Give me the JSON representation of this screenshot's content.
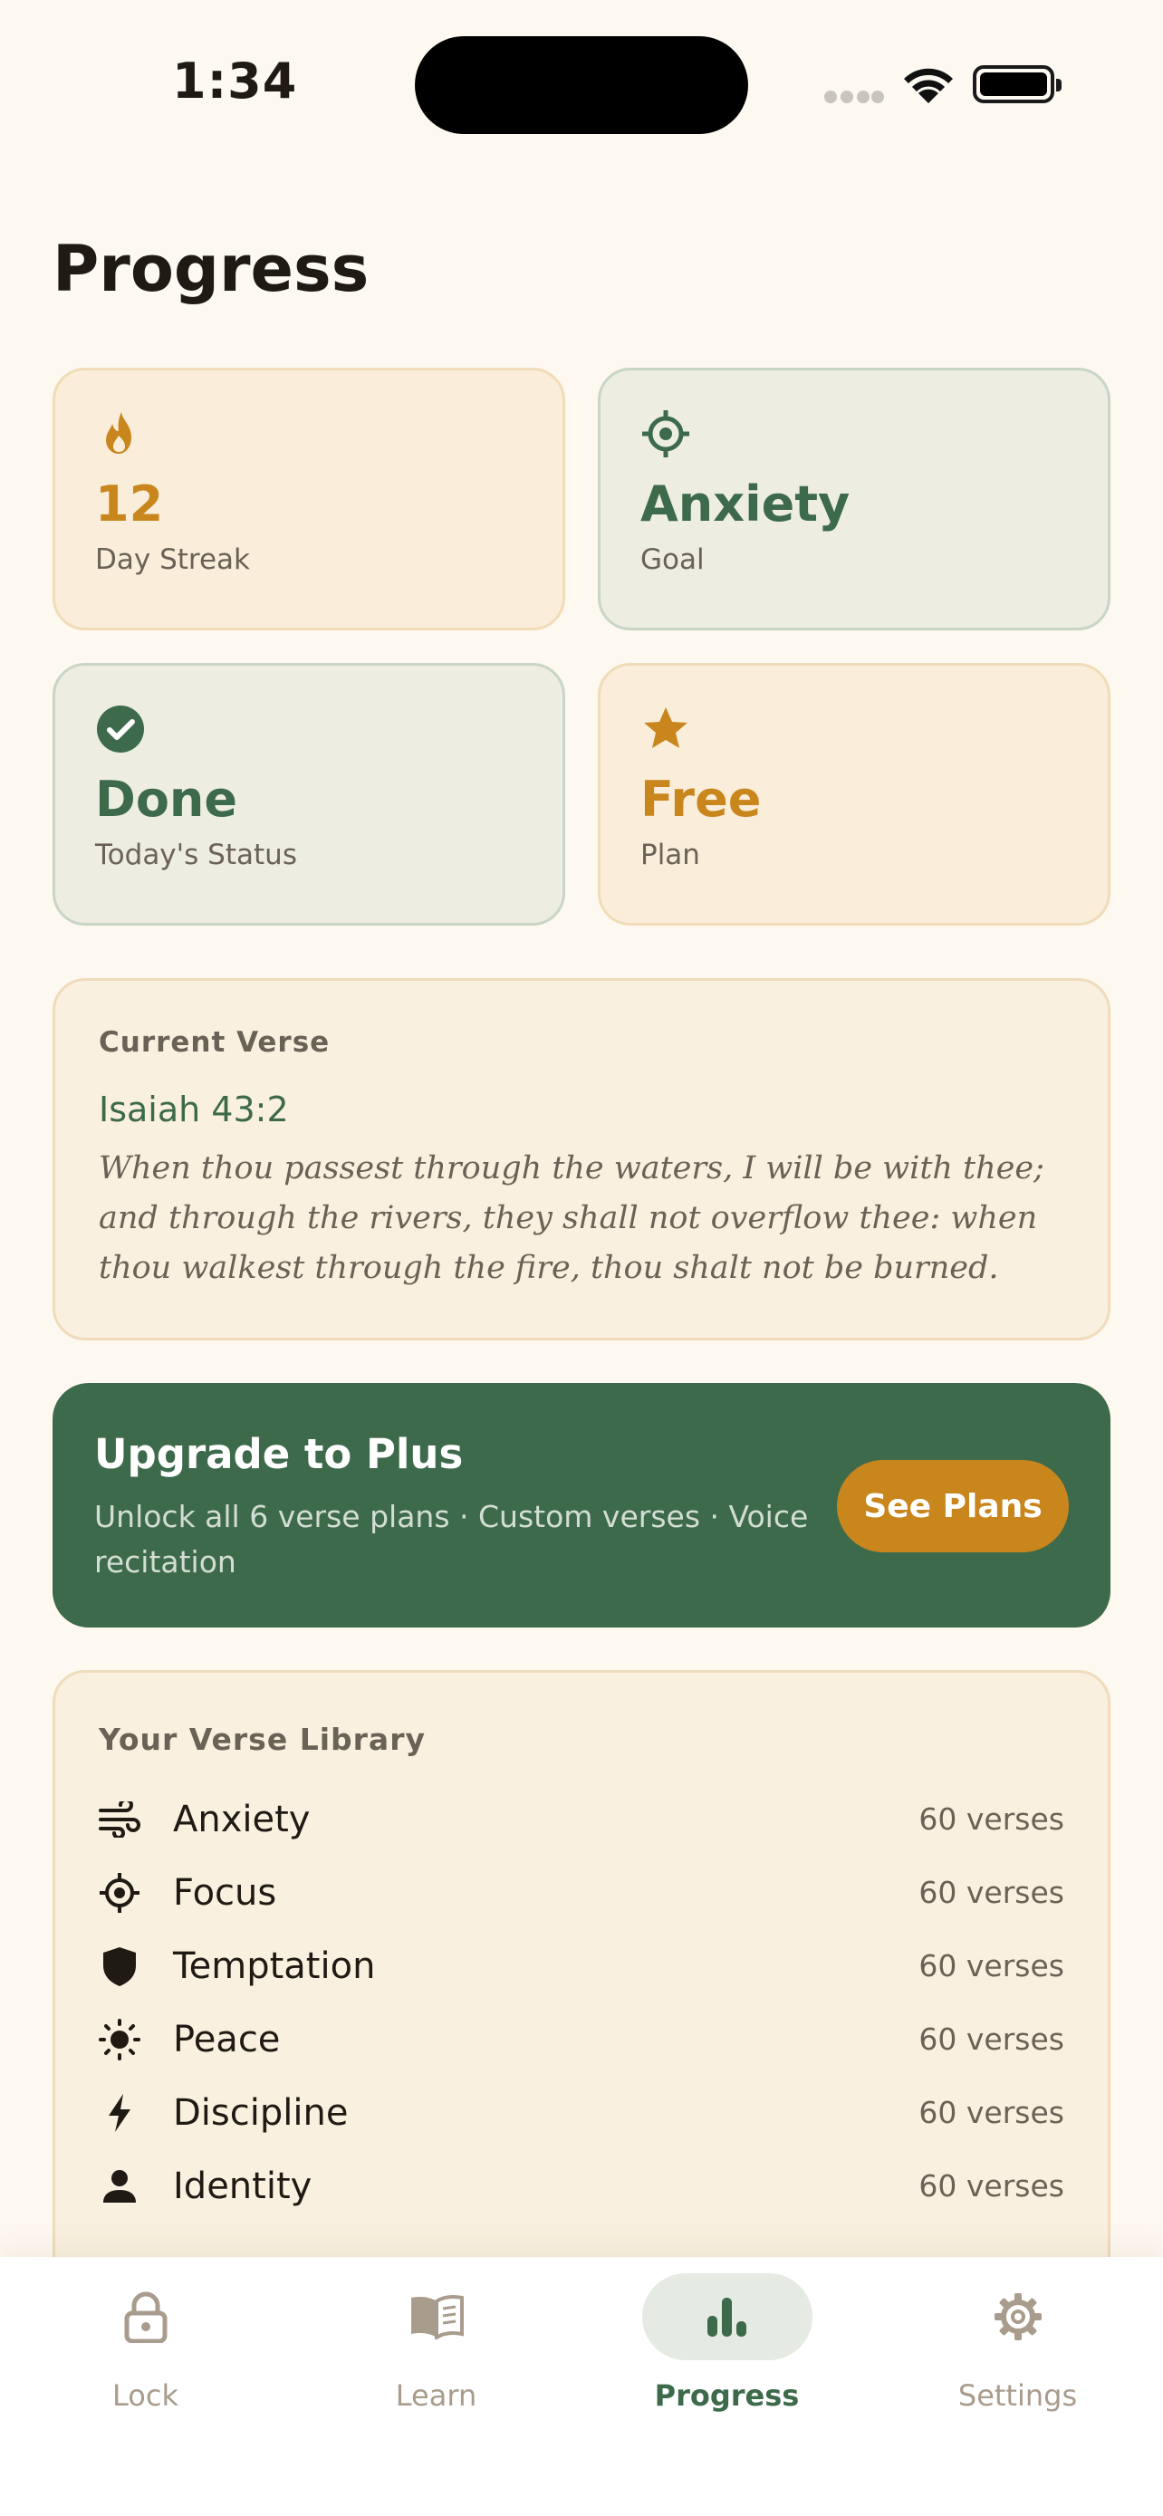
{
  "status_bar": {
    "time": "1:34"
  },
  "page": {
    "title": "Progress"
  },
  "stats": [
    {
      "value": "12",
      "label": "Day Streak",
      "icon": "flame-icon"
    },
    {
      "value": "Anxiety",
      "label": "Goal",
      "icon": "target-icon"
    },
    {
      "value": "Done",
      "label": "Today's Status",
      "icon": "check-circle-icon"
    },
    {
      "value": "Free",
      "label": "Plan",
      "icon": "star-icon"
    }
  ],
  "current_verse": {
    "heading": "Current Verse",
    "reference": "Isaiah 43:2",
    "text": "When thou passest through the waters, I will be with thee; and through the rivers, they shall not overflow thee: when thou walkest through the fire, thou shalt not be burned."
  },
  "upgrade": {
    "title": "Upgrade to Plus",
    "subtitle": "Unlock all 6 verse plans · Custom verses · Voice recitation",
    "button_label": "See Plans"
  },
  "library": {
    "heading": "Your Verse Library",
    "items": [
      {
        "name": "Anxiety",
        "count": "60 verses",
        "icon": "wind-icon"
      },
      {
        "name": "Focus",
        "count": "60 verses",
        "icon": "target-icon"
      },
      {
        "name": "Temptation",
        "count": "60 verses",
        "icon": "shield-icon"
      },
      {
        "name": "Peace",
        "count": "60 verses",
        "icon": "sun-icon"
      },
      {
        "name": "Discipline",
        "count": "60 verses",
        "icon": "bolt-icon"
      },
      {
        "name": "Identity",
        "count": "60 verses",
        "icon": "person-icon"
      }
    ]
  },
  "tabs": [
    {
      "label": "Lock",
      "icon": "lock-icon",
      "active": false
    },
    {
      "label": "Learn",
      "icon": "book-icon",
      "active": false
    },
    {
      "label": "Progress",
      "icon": "bar-chart-icon",
      "active": true
    },
    {
      "label": "Settings",
      "icon": "gear-icon",
      "active": false
    }
  ],
  "colors": {
    "background": "#fdf8f0",
    "accent_green": "#3d6a4b",
    "accent_amber": "#c9861d"
  }
}
